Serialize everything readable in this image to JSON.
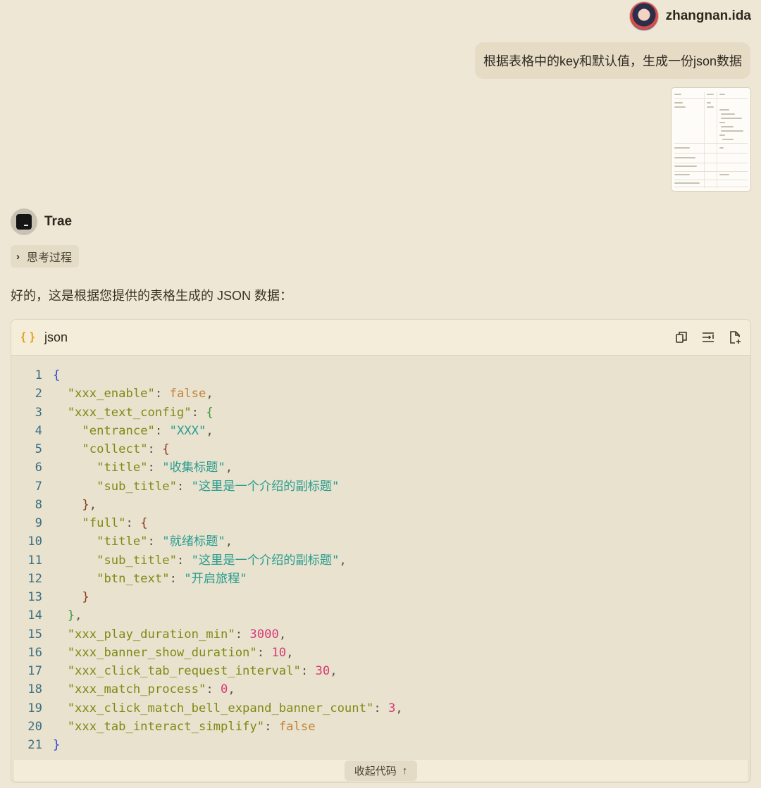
{
  "user": {
    "name": "zhangnan.ida"
  },
  "user_message": {
    "text": "根据表格中的key和默认值，生成一份json数据"
  },
  "assistant": {
    "name": "Trae",
    "thinking_label": "思考过程",
    "reply_text": "好的，这是根据您提供的表格生成的 JSON 数据："
  },
  "code_block": {
    "lang_icon": "{ }",
    "lang": "json",
    "collapse_label": "收起代码",
    "collapse_arrow": "↑",
    "tools": [
      "copy-icon",
      "wrap-icon",
      "new-file-icon"
    ],
    "lines": [
      [
        [
          "{",
          "br1"
        ]
      ],
      [
        [
          "  ",
          ""
        ],
        [
          "\"xxx_enable\"",
          "k"
        ],
        [
          ": ",
          "p"
        ],
        [
          "false",
          "b"
        ],
        [
          ",",
          "p"
        ]
      ],
      [
        [
          "  ",
          ""
        ],
        [
          "\"xxx_text_config\"",
          "k"
        ],
        [
          ": ",
          "p"
        ],
        [
          "{",
          "br2"
        ]
      ],
      [
        [
          "    ",
          ""
        ],
        [
          "\"entrance\"",
          "k"
        ],
        [
          ": ",
          "p"
        ],
        [
          "\"XXX\"",
          "s"
        ],
        [
          ",",
          "p"
        ]
      ],
      [
        [
          "    ",
          ""
        ],
        [
          "\"collect\"",
          "k"
        ],
        [
          ": ",
          "p"
        ],
        [
          "{",
          "br3"
        ]
      ],
      [
        [
          "      ",
          ""
        ],
        [
          "\"title\"",
          "k"
        ],
        [
          ": ",
          "p"
        ],
        [
          "\"收集标题\"",
          "s"
        ],
        [
          ",",
          "p"
        ]
      ],
      [
        [
          "      ",
          ""
        ],
        [
          "\"sub_title\"",
          "k"
        ],
        [
          ": ",
          "p"
        ],
        [
          "\"这里是一个介绍的副标题\"",
          "s"
        ]
      ],
      [
        [
          "    ",
          ""
        ],
        [
          "}",
          "br3"
        ],
        [
          ",",
          "p"
        ]
      ],
      [
        [
          "    ",
          ""
        ],
        [
          "\"full\"",
          "k"
        ],
        [
          ": ",
          "p"
        ],
        [
          "{",
          "br3"
        ]
      ],
      [
        [
          "      ",
          ""
        ],
        [
          "\"title\"",
          "k"
        ],
        [
          ": ",
          "p"
        ],
        [
          "\"就绪标题\"",
          "s"
        ],
        [
          ",",
          "p"
        ]
      ],
      [
        [
          "      ",
          ""
        ],
        [
          "\"sub_title\"",
          "k"
        ],
        [
          ": ",
          "p"
        ],
        [
          "\"这里是一个介绍的副标题\"",
          "s"
        ],
        [
          ",",
          "p"
        ]
      ],
      [
        [
          "      ",
          ""
        ],
        [
          "\"btn_text\"",
          "k"
        ],
        [
          ": ",
          "p"
        ],
        [
          "\"开启旅程\"",
          "s"
        ]
      ],
      [
        [
          "    ",
          ""
        ],
        [
          "}",
          "br3"
        ]
      ],
      [
        [
          "  ",
          ""
        ],
        [
          "}",
          "br2"
        ],
        [
          ",",
          "p"
        ]
      ],
      [
        [
          "  ",
          ""
        ],
        [
          "\"xxx_play_duration_min\"",
          "k"
        ],
        [
          ": ",
          "p"
        ],
        [
          "3000",
          "n"
        ],
        [
          ",",
          "p"
        ]
      ],
      [
        [
          "  ",
          ""
        ],
        [
          "\"xxx_banner_show_duration\"",
          "k"
        ],
        [
          ": ",
          "p"
        ],
        [
          "10",
          "n"
        ],
        [
          ",",
          "p"
        ]
      ],
      [
        [
          "  ",
          ""
        ],
        [
          "\"xxx_click_tab_request_interval\"",
          "k"
        ],
        [
          ": ",
          "p"
        ],
        [
          "30",
          "n"
        ],
        [
          ",",
          "p"
        ]
      ],
      [
        [
          "  ",
          ""
        ],
        [
          "\"xxx_match_process\"",
          "k"
        ],
        [
          ": ",
          "p"
        ],
        [
          "0",
          "n"
        ],
        [
          ",",
          "p"
        ]
      ],
      [
        [
          "  ",
          ""
        ],
        [
          "\"xxx_click_match_bell_expand_banner_count\"",
          "k"
        ],
        [
          ": ",
          "p"
        ],
        [
          "3",
          "n"
        ],
        [
          ",",
          "p"
        ]
      ],
      [
        [
          "  ",
          ""
        ],
        [
          "\"xxx_tab_interact_simplify\"",
          "k"
        ],
        [
          ": ",
          "p"
        ],
        [
          "false",
          "b"
        ]
      ],
      [
        [
          "}",
          "br1"
        ]
      ]
    ]
  }
}
